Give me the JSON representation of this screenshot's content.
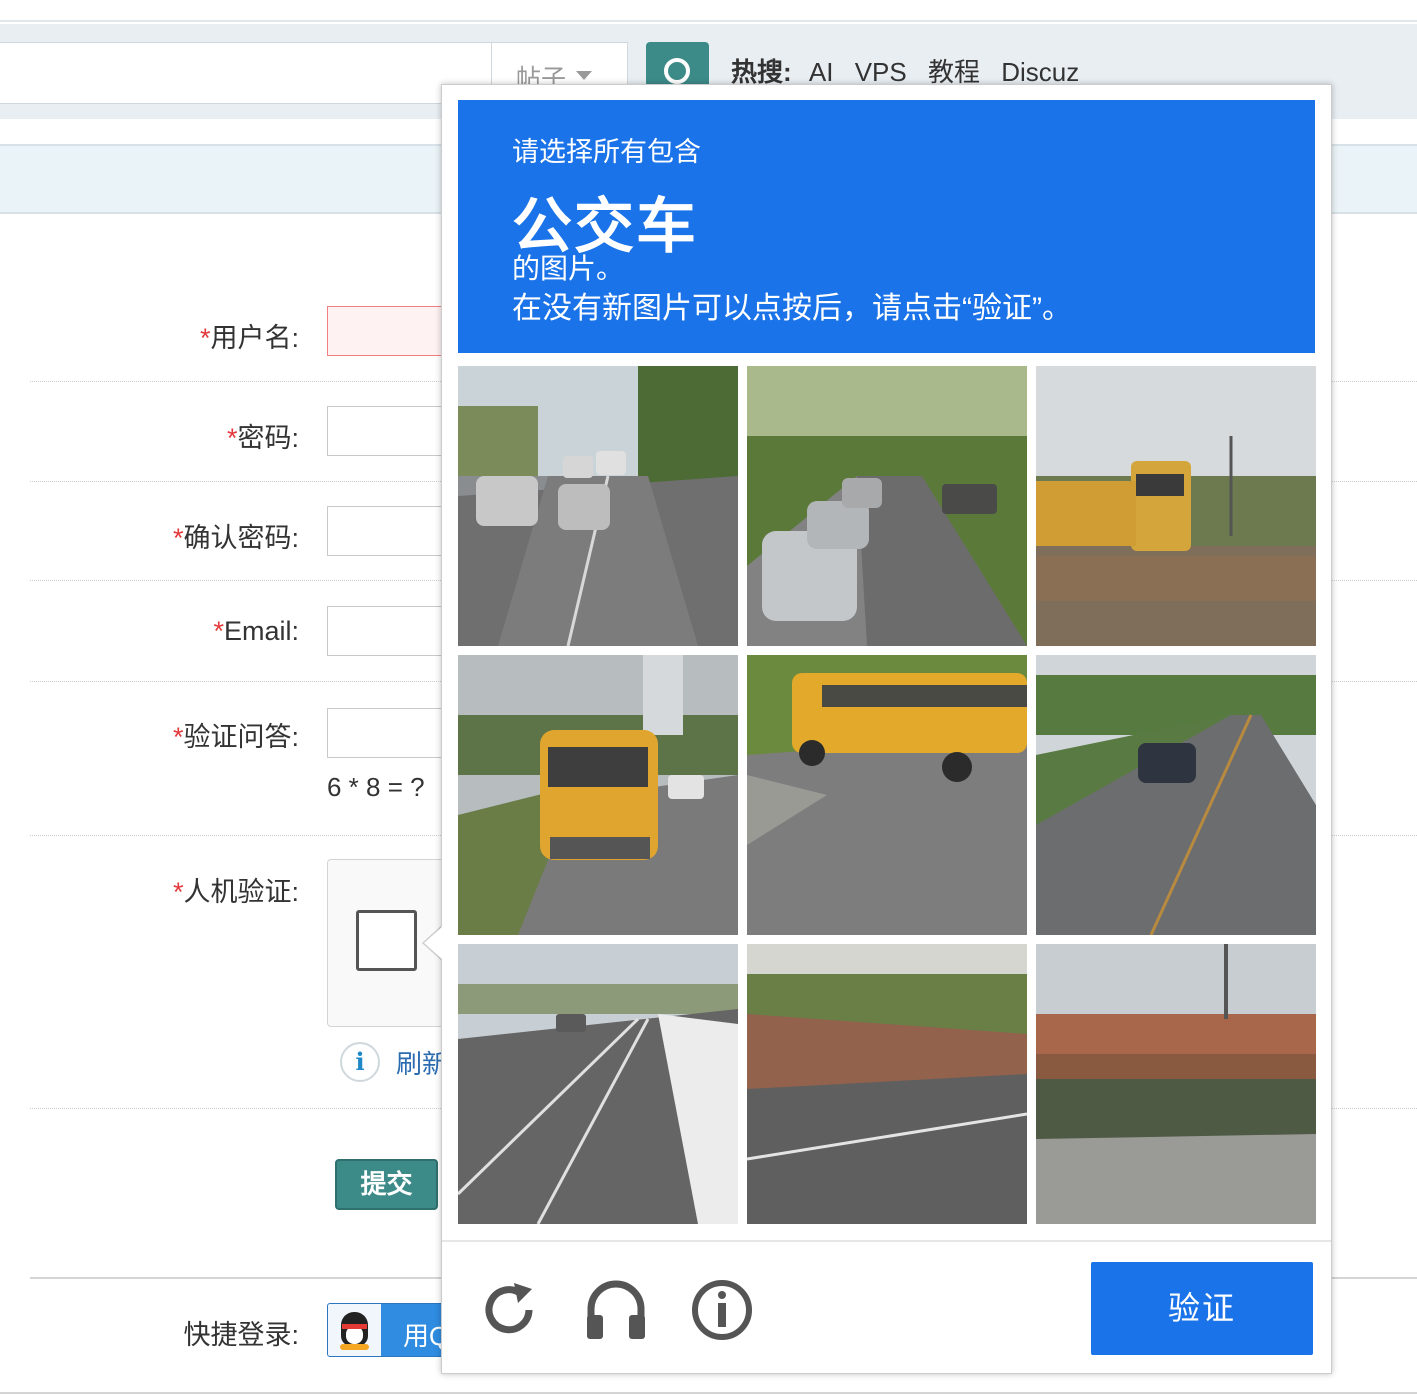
{
  "colors": {
    "brand_teal": "#3d8b89",
    "captcha_blue": "#1a73e8",
    "required_red": "#e4393c",
    "link_blue": "#2b6cb0"
  },
  "search": {
    "type_label": "帖子",
    "hot_label": "热搜:",
    "hot_keywords": [
      "AI",
      "VPS",
      "教程",
      "Discuz"
    ]
  },
  "form": {
    "required_mark": "*",
    "username_label": "用户名:",
    "password_label": "密码:",
    "confirm_password_label": "确认密码:",
    "email_label": "Email:",
    "question_label": "验证问答:",
    "question_text": "6 * 8 = ?",
    "captcha_label": "人机验证:",
    "refresh_text": "刷新",
    "submit_label": "提交",
    "quick_login_label": "快捷登录:",
    "qq_login_text": "用QQ"
  },
  "captcha": {
    "instruction_line1": "请选择所有包含",
    "target_object": "公交车",
    "instruction_line3": "的图片。",
    "instruction_line4": "在没有新图片可以点按后，请点击“验证”。",
    "verify_label": "验证",
    "tiles": [
      "street-cars",
      "street-cars-trees",
      "school-bus",
      "school-bus",
      "school-bus",
      "street-car",
      "road",
      "road-wall",
      "overpass"
    ],
    "tools": [
      "reload-icon",
      "audio-icon",
      "info-icon"
    ]
  }
}
